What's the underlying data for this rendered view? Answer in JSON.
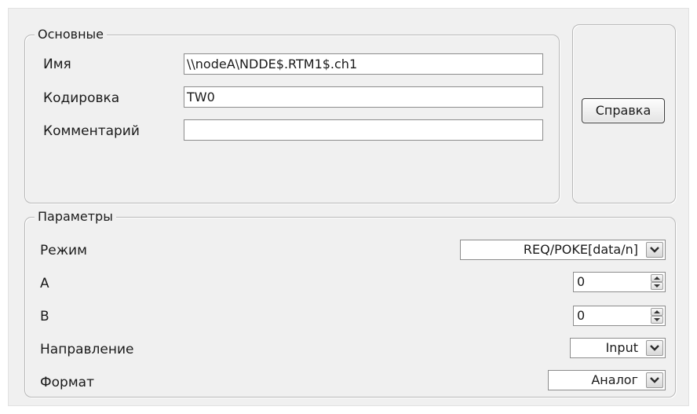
{
  "main_group": {
    "title": "Основные",
    "name_label": "Имя",
    "name_value": "\\\\nodeA\\NDDE$.RTM1$.ch1",
    "encoding_label": "Кодировка",
    "encoding_value": "TW0",
    "comment_label": "Комментарий",
    "comment_value": ""
  },
  "help_button_label": "Справка",
  "params_group": {
    "title": "Параметры",
    "mode_label": "Режим",
    "mode_value": "REQ/POKE[data/n]",
    "a_label": "A",
    "a_value": "0",
    "b_label": "B",
    "b_value": "0",
    "direction_label": "Направление",
    "direction_value": "Input",
    "format_label": "Формат",
    "format_value": "Аналог"
  },
  "icons": {
    "dropdown": "chevron-down-icon",
    "spin_up": "spin-up-icon",
    "spin_down": "spin-down-icon"
  }
}
